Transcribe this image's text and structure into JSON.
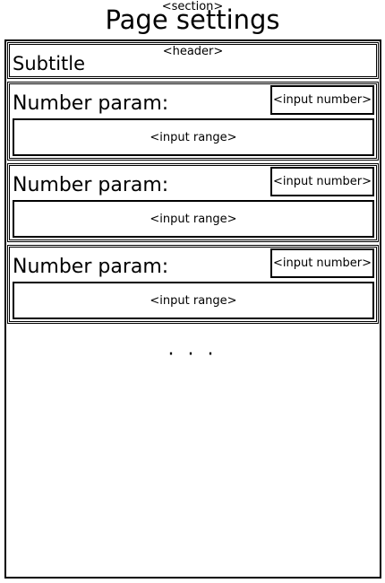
{
  "section": {
    "tag": "<section>",
    "title": "Page settings"
  },
  "header": {
    "tag": "<header>",
    "subtitle": "Subtitle"
  },
  "params": [
    {
      "label": "Number param:",
      "number_input": "<input number>",
      "range_input": "<input range>"
    },
    {
      "label": "Number param:",
      "number_input": "<input number>",
      "range_input": "<input range>"
    },
    {
      "label": "Number param:",
      "number_input": "<input number>",
      "range_input": "<input range>"
    }
  ],
  "more": "· · ·"
}
